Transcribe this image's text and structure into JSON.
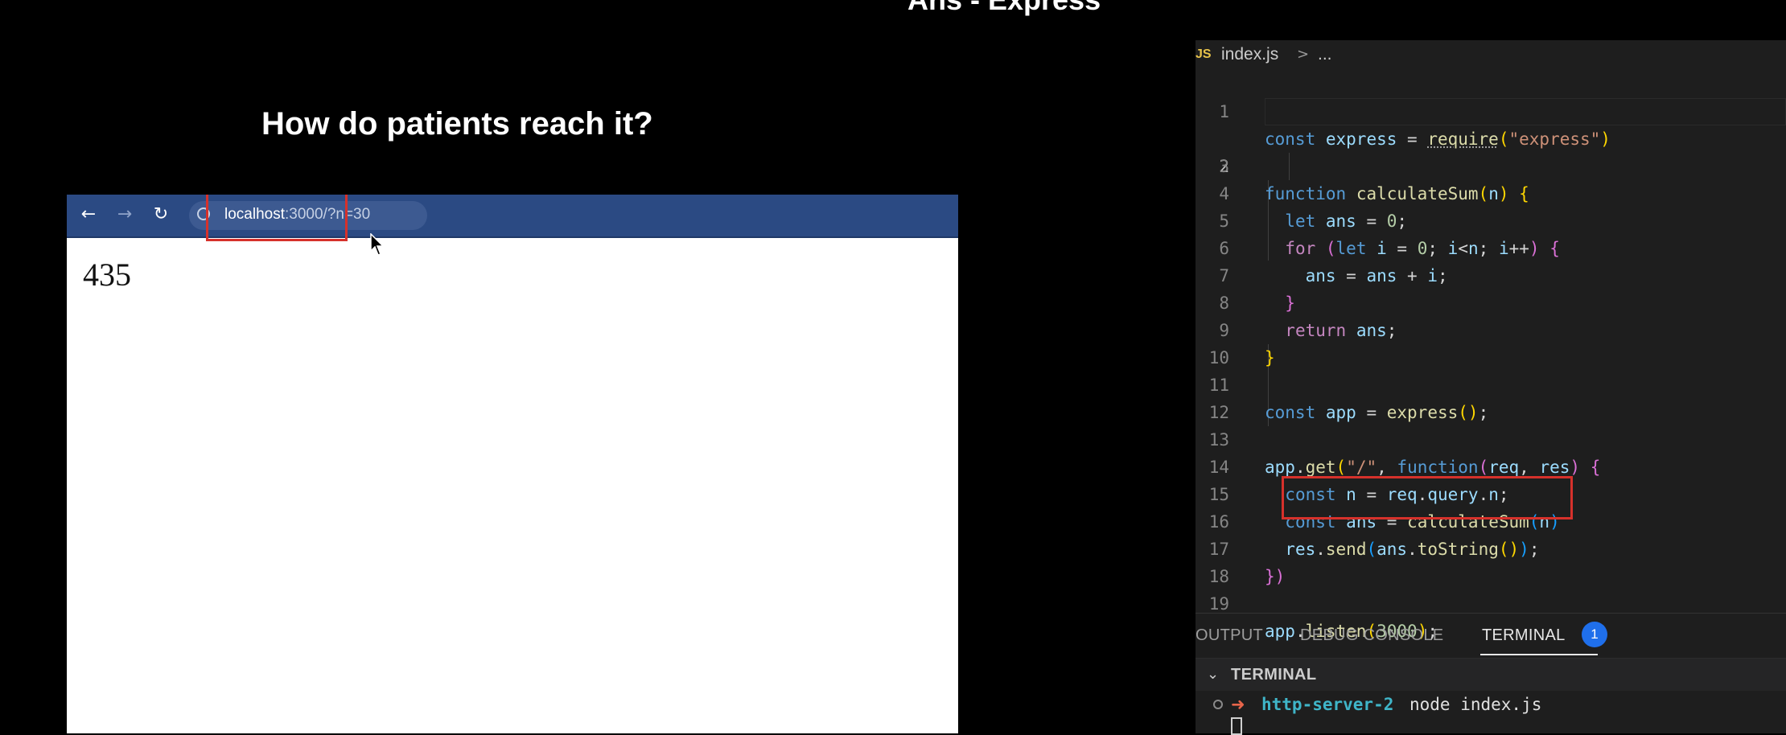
{
  "slide": {
    "title": "Ans - Express",
    "subtitle": "How do patients reach it?"
  },
  "browser": {
    "back_icon": "arrow-left-icon",
    "forward_icon": "arrow-right-icon",
    "reload_icon": "reload-icon",
    "info_icon": "info-circle-icon",
    "address_host": "localhost",
    "address_rest": ":3000/?n=30",
    "page_output": "435",
    "highlight_color": "#d6312b",
    "toolbar_color": "#2b4a83"
  },
  "editor": {
    "breadcrumb": {
      "lang_badge": "JS",
      "file": "index.js",
      "separator": ">",
      "more": "..."
    },
    "active_line": 2,
    "lines": [
      {
        "num": "1"
      },
      {
        "num": "2"
      },
      {
        "num": "3"
      },
      {
        "num": "4"
      },
      {
        "num": "5"
      },
      {
        "num": "6"
      },
      {
        "num": "7"
      },
      {
        "num": "8"
      },
      {
        "num": "9"
      },
      {
        "num": "10"
      },
      {
        "num": "11"
      },
      {
        "num": "12"
      },
      {
        "num": "13"
      },
      {
        "num": "14"
      },
      {
        "num": "15"
      },
      {
        "num": "16"
      },
      {
        "num": "17"
      },
      {
        "num": "18"
      },
      {
        "num": "19"
      }
    ],
    "code": {
      "l1": {
        "kw": "const",
        "name": "express",
        "eq": " = ",
        "fn": "require",
        "open": "(",
        "str": "\"express\"",
        "close": ")"
      },
      "l3": {
        "kw": "function",
        "fn": "calculateSum",
        "open": "(",
        "param": "n",
        "close": ")",
        "brace": " {"
      },
      "l4": {
        "kw": "let",
        "name": "ans",
        "eq": " = ",
        "num": "0",
        "semi": ";"
      },
      "l5": {
        "kw": "for",
        "open": " (",
        "kw2": "let",
        "i": "i",
        "eq": " = ",
        "num": "0",
        "semi1": "; ",
        "i2": "i",
        "lt": "<",
        "n": "n",
        "semi2": "; ",
        "i3": "i",
        "inc": "++",
        "close": ")",
        "brace": " {"
      },
      "l6": {
        "name": "ans",
        "eq": " = ",
        "name2": "ans",
        "plus": " + ",
        "i": "i",
        "semi": ";"
      },
      "l7": {
        "brace": "}"
      },
      "l8": {
        "kw": "return",
        "name": "ans",
        "semi": ";"
      },
      "l9": {
        "brace": "}"
      },
      "l11": {
        "kw": "const",
        "name": "app",
        "eq": " = ",
        "fn": "express",
        "parens": "()",
        "semi": ";"
      },
      "l13": {
        "obj": "app",
        "dot": ".",
        "fn": "get",
        "open": "(",
        "str": "\"/\"",
        "comma": ", ",
        "kw": "function",
        "open2": "(",
        "p1": "req",
        "comma2": ", ",
        "p2": "res",
        "close2": ")",
        "brace": " {"
      },
      "l14": {
        "kw": "const",
        "name": "n",
        "eq": " = ",
        "obj": "req",
        "dot": ".",
        "prop": "query",
        "dot2": ".",
        "prop2": "n",
        "semi": ";"
      },
      "l15": {
        "kw": "const",
        "name": "ans",
        "eq": " = ",
        "fn": "calculateSum",
        "open": "(",
        "arg": "n",
        "close": ")"
      },
      "l16": {
        "obj": "res",
        "dot": ".",
        "fn": "send",
        "open": "(",
        "obj2": "ans",
        "dot2": ".",
        "fn2": "toString",
        "parens": "()",
        "close": ")",
        "semi": ";"
      },
      "l17": {
        "brace": "})"
      },
      "l19": {
        "obj": "app",
        "dot": ".",
        "fn": "listen",
        "open": "(",
        "num": "3000",
        "close": ")",
        "semi": ";"
      }
    }
  },
  "panel": {
    "tabs": [
      {
        "label": "OUTPUT"
      },
      {
        "label": "DEBUG CONSOLE"
      },
      {
        "label": "TERMINAL"
      }
    ],
    "active_tab": "TERMINAL",
    "terminal_badge": "1",
    "terminal_section_title": "TERMINAL",
    "terminal_chevron_icon": "chevron-down-icon",
    "terminal": {
      "arrow": "➜",
      "dir": "http-server-2",
      "command": "node index.js"
    }
  }
}
